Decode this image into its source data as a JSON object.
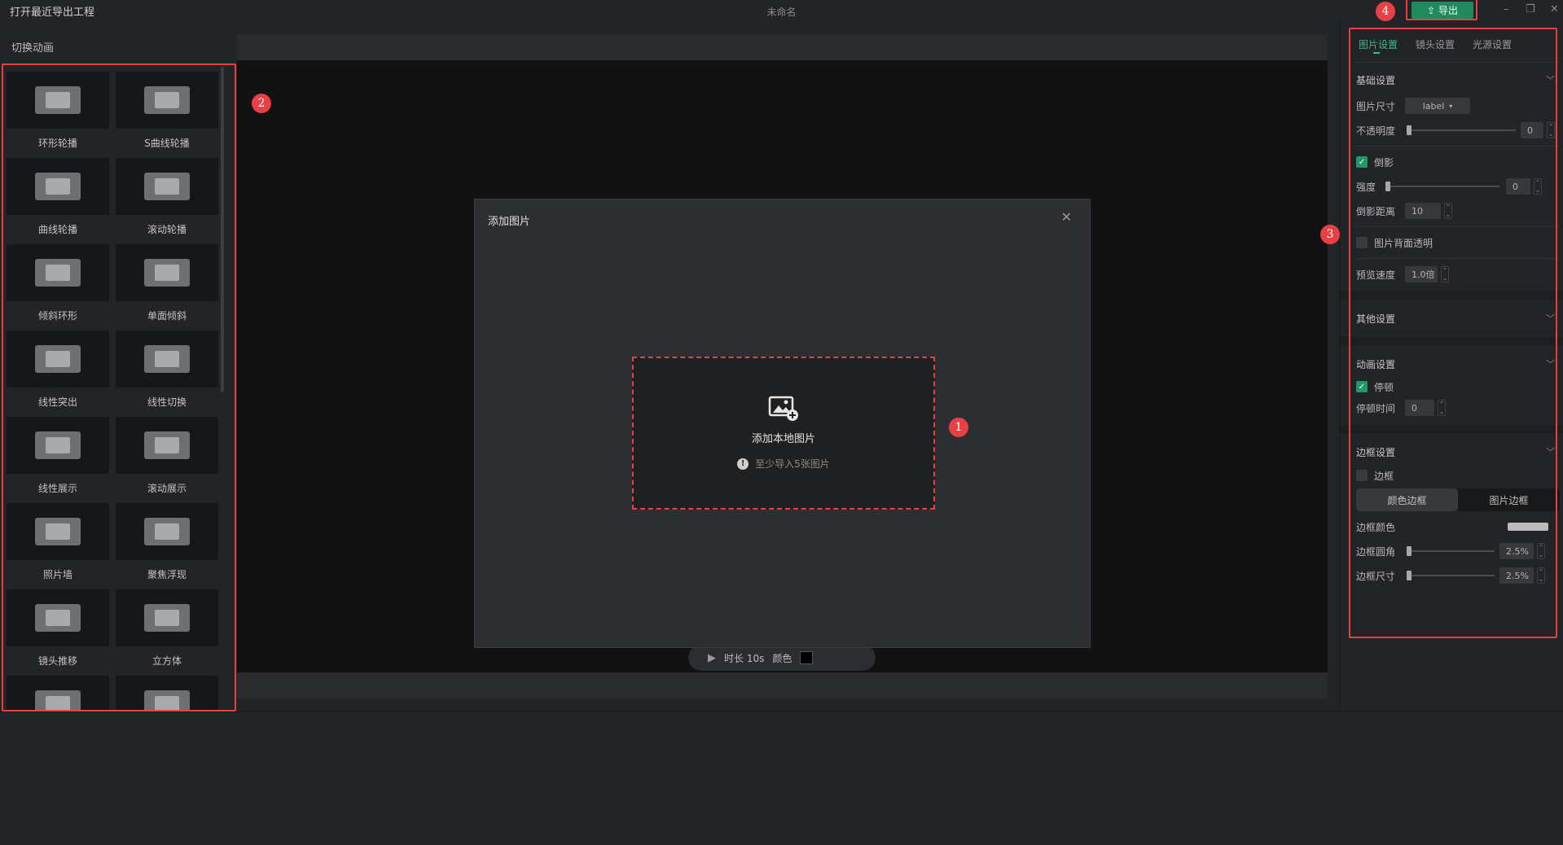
{
  "titlebar": {
    "recent_project": "打开最近导出工程",
    "document_title": "未命名",
    "export_label": "导出",
    "minimize": "–",
    "restore": "❐",
    "close": "✕"
  },
  "left_panel": {
    "header": "切换动画",
    "items": [
      {
        "label": "环形轮播",
        "icon": "ring-carousel-icon"
      },
      {
        "label": "S曲线轮播",
        "icon": "s-curve-carousel-icon"
      },
      {
        "label": "曲线轮播",
        "icon": "curve-carousel-icon"
      },
      {
        "label": "滚动轮播",
        "icon": "scroll-carousel-icon"
      },
      {
        "label": "倾斜环形",
        "icon": "tilted-ring-icon"
      },
      {
        "label": "单面倾斜",
        "icon": "single-tilt-icon"
      },
      {
        "label": "线性突出",
        "icon": "linear-highlight-icon"
      },
      {
        "label": "线性切换",
        "icon": "linear-switch-icon"
      },
      {
        "label": "线性展示",
        "icon": "linear-display-icon"
      },
      {
        "label": "滚动展示",
        "icon": "scroll-display-icon"
      },
      {
        "label": "照片墙",
        "icon": "photo-wall-icon"
      },
      {
        "label": "聚焦浮现",
        "icon": "focus-emerge-icon"
      },
      {
        "label": "镜头推移",
        "icon": "camera-push-icon"
      },
      {
        "label": "立方体",
        "icon": "cube-icon"
      },
      {
        "label": "",
        "icon": "partial-item-icon"
      },
      {
        "label": "",
        "icon": "partial-item-icon"
      }
    ]
  },
  "playbar": {
    "duration": "时长 10s",
    "color_label": "颜色"
  },
  "dialog": {
    "title": "添加图片",
    "dropzone_title": "添加本地图片",
    "dropzone_hint": "至少导入5张图片"
  },
  "annotations": {
    "badge1": "1",
    "badge2": "2",
    "badge3": "3",
    "badge4": "4"
  },
  "right_panel": {
    "tabs": [
      "图片设置",
      "镜头设置",
      "光源设置"
    ],
    "basic": {
      "header": "基础设置",
      "size_label": "图片尺寸",
      "size_value": "label",
      "opacity_label": "不透明度",
      "opacity_value": "0",
      "shadow_label": "倒影",
      "strength_label": "强度",
      "strength_value": "0",
      "shadow_distance_label": "倒影距离",
      "shadow_distance_value": "10",
      "transparent_back_label": "图片背面透明",
      "preview_speed_label": "预览速度",
      "preview_speed_value": "1.0倍"
    },
    "other": {
      "header": "其他设置"
    },
    "animation": {
      "header": "动画设置",
      "pause_label": "停顿",
      "pause_time_label": "停顿时间",
      "pause_time_value": "0"
    },
    "border": {
      "header": "边框设置",
      "border_label": "边框",
      "seg_color": "颜色边框",
      "seg_image": "图片边框",
      "color_label": "边框颜色",
      "radius_label": "边框圆角",
      "radius_value": "2.5%",
      "size_label": "边框尺寸",
      "size_value": "2.5%"
    }
  },
  "colors": {
    "accent": "#3dbb85",
    "export_button": "#1f8a5d",
    "annotation_red": "#e84145"
  }
}
